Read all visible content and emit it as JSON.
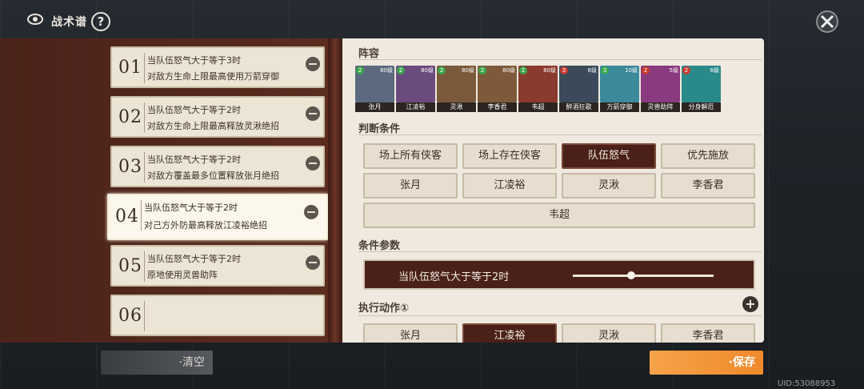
{
  "header": {
    "title": "战术谱",
    "help_label": "?"
  },
  "tactics": [
    {
      "num": "01",
      "line1": "当队伍怒气大于等于3时",
      "line2": "对敌方生命上限最高使用万箭穿御"
    },
    {
      "num": "02",
      "line1": "当队伍怒气大于等于2时",
      "line2": "对敌方生命上限最高释放灵湫绝招"
    },
    {
      "num": "03",
      "line1": "当队伍怒气大于等于2时",
      "line2": "对敌方覆盖最多位置释放张月绝招"
    },
    {
      "num": "04",
      "line1": "当队伍怒气大于等于2时",
      "line2": "对己方外防最高释放江凌裕绝招"
    },
    {
      "num": "05",
      "line1": "当队伍怒气大于等于2时",
      "line2": "原地使用灵兽助阵"
    },
    {
      "num": "06",
      "line1": "",
      "line2": ""
    }
  ],
  "roster": {
    "title": "阵容",
    "heroes": [
      {
        "name": "张月",
        "level": "80级",
        "star": "2",
        "color": "#5b6a7e"
      },
      {
        "name": "江凌裕",
        "level": "80级",
        "star": "2",
        "color": "#6a4b7e"
      },
      {
        "name": "灵湫",
        "level": "80级",
        "star": "2",
        "color": "#7a5a3a"
      },
      {
        "name": "李香君",
        "level": "80级",
        "star": "2",
        "color": "#7e5a3a"
      },
      {
        "name": "韦超",
        "level": "80级",
        "star": "2",
        "color": "#8a3a2e"
      },
      {
        "name": "醉酒狂歌",
        "level": "8级",
        "star": "3",
        "color": "#3a4a5a"
      },
      {
        "name": "万箭穿御",
        "level": "10级",
        "star": "3",
        "color": "#3a8a9a"
      },
      {
        "name": "灵兽助阵",
        "level": "5级",
        "star": "2",
        "color": "#8a3a7e"
      },
      {
        "name": "分身解厄",
        "level": "6级",
        "star": "2",
        "color": "#2a8a8a"
      }
    ]
  },
  "conditions": {
    "title": "判断条件",
    "buttons": [
      "场上所有侠客",
      "场上存在侠客",
      "队伍怒气",
      "优先施放",
      "张月",
      "江凌裕",
      "灵湫",
      "李香君",
      "韦超"
    ],
    "active_index": 2
  },
  "params": {
    "title": "条件参数",
    "label": "当队伍怒气大于等于2时"
  },
  "actions": {
    "title": "执行动作①",
    "buttons": [
      "张月",
      "江凌裕",
      "灵湫",
      "李香君"
    ],
    "active_index": 1
  },
  "footer": {
    "clear": "·清空",
    "save": "·保存",
    "uid": "UID:53088953"
  },
  "colors": {
    "panel": "#5a2e22",
    "page": "#efe9df",
    "active": "#4a2018",
    "save": "#ef8a2a"
  }
}
